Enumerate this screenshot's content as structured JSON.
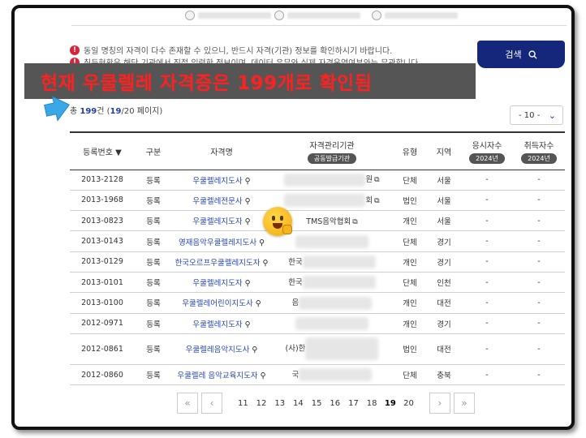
{
  "notices": [
    "동일 명칭의 자격이 다수 존재할 수 있으니, 반드시 자격(기관) 정보를 확인하시기 바랍니다.",
    "취득현황은 해당 기관에서 직접 입력한 정보이며, 데이터 유무와 실제 자격운영여부와는 무관합니다."
  ],
  "search": {
    "label": "검색",
    "icon": "search-icon"
  },
  "overlay_caption": "현재 우쿨렐레 자격증은 199개로 확인됨",
  "result": {
    "prefix": "총 ",
    "total": "199",
    "unit": "건 (",
    "page": "19",
    "pages": "/20 페이지)"
  },
  "page_size": {
    "value": "- 10 -"
  },
  "table": {
    "headers": {
      "reg_no": "등록번호 ▼",
      "type": "구분",
      "name": "자격명",
      "org": "자격관리기관",
      "org_sub": "공동발급기관",
      "kind": "유형",
      "region": "지역",
      "applicants": "응시자수",
      "applicants_year": "2024년",
      "acquirers": "취득자수",
      "acquirers_year": "2024년"
    },
    "rows": [
      {
        "reg_no": "2013-2128",
        "type": "등록",
        "name": "우쿨렐레지도사",
        "org": "원",
        "kind": "단체",
        "region": "서울",
        "applicants": "-",
        "acquirers": "-"
      },
      {
        "reg_no": "2013-1968",
        "type": "등록",
        "name": "우쿨렐레전문사",
        "org": "회",
        "kind": "법인",
        "region": "서울",
        "applicants": "-",
        "acquirers": "-"
      },
      {
        "reg_no": "2013-0823",
        "type": "등록",
        "name": "우쿨렐레지도자",
        "org": "TMS음악협회",
        "kind": "개인",
        "region": "서울",
        "applicants": "-",
        "acquirers": "-"
      },
      {
        "reg_no": "2013-0143",
        "type": "등록",
        "name": "영재음악우쿨렐레지도사",
        "org": "",
        "kind": "단체",
        "region": "경기",
        "applicants": "-",
        "acquirers": "-"
      },
      {
        "reg_no": "2013-0129",
        "type": "등록",
        "name": "한국오르프우쿨렐레지도자",
        "org": "한국",
        "kind": "개인",
        "region": "경기",
        "applicants": "-",
        "acquirers": "-"
      },
      {
        "reg_no": "2013-0101",
        "type": "등록",
        "name": "우쿨렐레지도자",
        "org": "한국",
        "kind": "단체",
        "region": "인천",
        "applicants": "-",
        "acquirers": "-"
      },
      {
        "reg_no": "2013-0100",
        "type": "등록",
        "name": "우쿨렐레어린이지도사",
        "org": "음",
        "kind": "개인",
        "region": "대전",
        "applicants": "-",
        "acquirers": "-"
      },
      {
        "reg_no": "2012-0971",
        "type": "등록",
        "name": "우쿨렐레지도자",
        "org": "",
        "kind": "개인",
        "region": "경기",
        "applicants": "-",
        "acquirers": "-"
      },
      {
        "reg_no": "2012-0861",
        "type": "등록",
        "name": "우쿨렐레음악지도사",
        "org": "(사)한",
        "kind": "법인",
        "region": "대전",
        "applicants": "-",
        "acquirers": "-"
      },
      {
        "reg_no": "2012-0860",
        "type": "등록",
        "name": "우쿨렐레 음악교육지도자",
        "org": "국",
        "kind": "단체",
        "region": "충북",
        "applicants": "-",
        "acquirers": "-"
      }
    ]
  },
  "pagination": {
    "first": "«",
    "prev": "‹",
    "next": "›",
    "last": "»",
    "pages": [
      "11",
      "12",
      "13",
      "14",
      "15",
      "16",
      "17",
      "18",
      "19",
      "20"
    ],
    "current": "19"
  }
}
